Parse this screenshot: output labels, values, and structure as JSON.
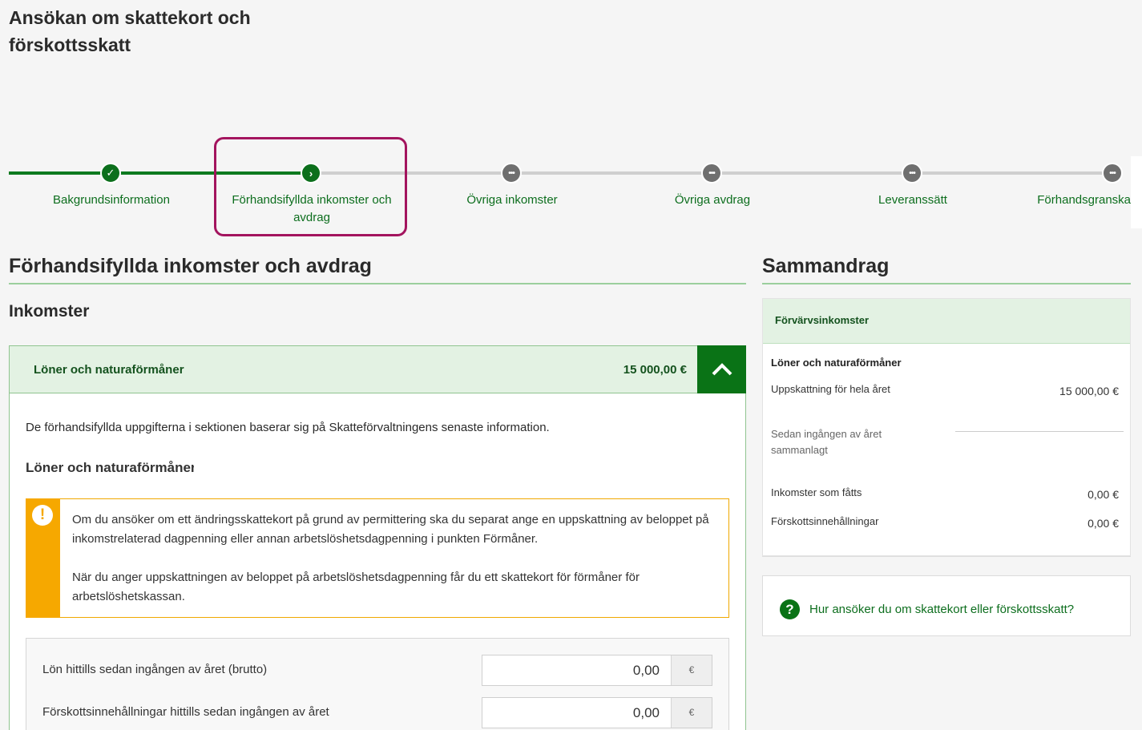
{
  "app": {
    "title": "Ansökan om skattekort och förskottsskatt"
  },
  "stepper": {
    "steps": [
      {
        "label": "Bakgrundsinformation",
        "state": "done",
        "icon": "check-icon"
      },
      {
        "label": "Förhandsifyllda inkomster och avdrag",
        "state": "current",
        "icon": "chevron-right-icon"
      },
      {
        "label": "Övriga inkomster",
        "state": "todo",
        "icon": "ellipsis-icon"
      },
      {
        "label": "Övriga avdrag",
        "state": "todo",
        "icon": "ellipsis-icon"
      },
      {
        "label": "Leveranssätt",
        "state": "todo",
        "icon": "ellipsis-icon"
      },
      {
        "label": "Förhandsgranska",
        "state": "todo",
        "icon": "ellipsis-icon"
      }
    ]
  },
  "main": {
    "heading": "Förhandsifyllda inkomster och avdrag",
    "subheading": "Inkomster",
    "accordion": {
      "title": "Löner och naturaförmåner",
      "amount": "15 000,00 €",
      "info": "De förhandsifyllda uppgifterna i sektionen baserar sig på Skatteförvaltningens senaste information.",
      "section_label": "Löner och naturaförmåner",
      "notice": {
        "p1": "Om du ansöker om ett ändringsskattekort på grund av permittering ska du separat ange en uppskattning av beloppet på inkomstrelaterad dagpenning eller annan arbetslöshetsdagpenning i punkten Förmåner.",
        "p2": "När du anger uppskattningen av beloppet på arbetslöshetsdagpenning får du ett skattekort för förmåner för arbetslöshetskassan."
      },
      "fields": [
        {
          "label": "Lön hittills sedan ingången av året (brutto)",
          "value": "0,00",
          "unit": "€"
        },
        {
          "label": "Förskottsinnehållningar hittills sedan ingången av året",
          "value": "0,00",
          "unit": "€"
        }
      ]
    }
  },
  "summary": {
    "heading": "Sammandrag",
    "card_title": "Förvärvsinkomster",
    "group_title": "Löner och naturaförmåner",
    "rows": {
      "estimate_label": "Uppskattning för hela året",
      "estimate_value": "15 000,00 €",
      "since_label": "Sedan ingången av året sammanlagt",
      "income_label": "Inkomster som fåtts",
      "income_value": "0,00 €",
      "withholding_label": "Förskottsinnehållningar",
      "withholding_value": "0,00 €"
    },
    "help_link": "Hur ansöker du om skattekort eller förskottsskatt?"
  },
  "colors": {
    "accent": "#0a7316",
    "highlight": "#a3145e",
    "warning": "#f6a800"
  }
}
